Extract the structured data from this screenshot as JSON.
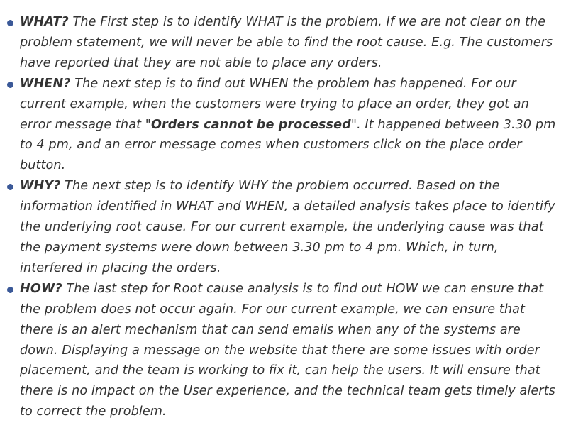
{
  "steps": [
    {
      "lead": "WHAT?",
      "text": " The First step is to identify WHAT is the problem. If we are not clear on the problem statement, we will never be able to find the root cause. E.g. The customers have reported that they are not able to place any orders."
    },
    {
      "lead": "WHEN?",
      "text_before": " The next step is to find out WHEN the problem has happened. For our current example, when the customers were trying to place an order, they got an error message that \"",
      "bold_quote": "Orders cannot be processed",
      "text_after": "\". It happened between 3.30 pm to 4 pm, and an error message comes when customers click on the place order button."
    },
    {
      "lead": "WHY?",
      "text": " The next step is to identify WHY the problem occurred. Based on the information identified in WHAT and WHEN, a detailed analysis takes place to identify the underlying root cause. For our current example, the underlying cause was that the payment systems were down between 3.30 pm to 4 pm. Which, in turn, interfered in placing the orders."
    },
    {
      "lead": "HOW?",
      "text": " The last step for Root cause analysis is to find out HOW we can ensure that the problem does not occur again. For our current example, we can ensure that there is an alert mechanism that can send emails when any of the systems are down. Displaying a message on the website that there are some issues with order placement, and the team is working to fix it, can help the users. It will ensure that there is no impact on the User experience, and the technical team gets timely alerts to correct the problem."
    }
  ],
  "colors": {
    "bullet": "#3b5998",
    "text": "#333333"
  }
}
